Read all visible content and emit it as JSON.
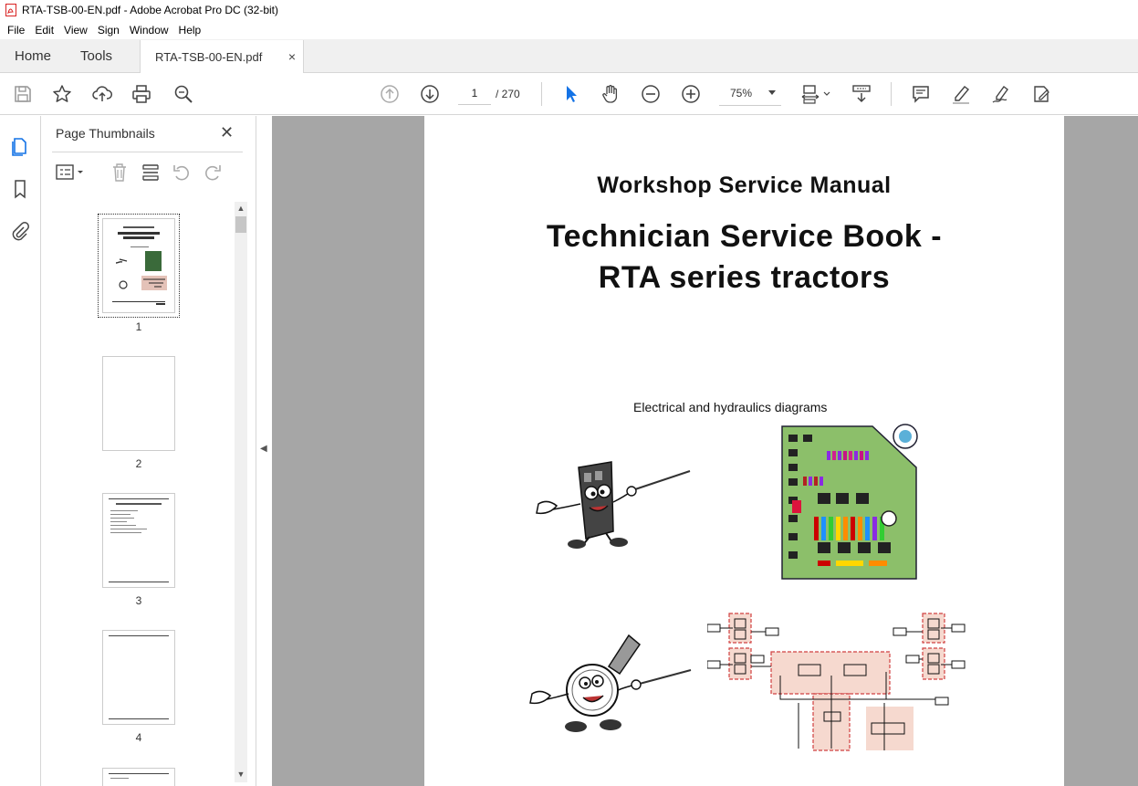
{
  "window": {
    "title": "RTA-TSB-00-EN.pdf - Adobe Acrobat Pro DC (32-bit)"
  },
  "menu": [
    "File",
    "Edit",
    "View",
    "Sign",
    "Window",
    "Help"
  ],
  "tabs": {
    "home": "Home",
    "tools": "Tools",
    "document": "RTA-TSB-00-EN.pdf",
    "close": "×"
  },
  "toolbar": {
    "current_page": "1",
    "total_pages": "/ 270",
    "zoom": "75%",
    "icons": [
      "save-icon",
      "star-icon",
      "upload-icon",
      "print-icon",
      "search-zoom-icon",
      "prev-page-icon",
      "next-page-icon",
      "select-cursor-icon",
      "hand-icon",
      "zoom-out-icon",
      "zoom-in-icon",
      "page-fit-icon",
      "scroll-mode-icon",
      "comment-icon",
      "highlight-icon",
      "sign-icon",
      "edit-pdf-icon"
    ]
  },
  "panel": {
    "title": "Page Thumbnails",
    "close": "✕",
    "thumbnails": [
      {
        "label": "1"
      },
      {
        "label": "2"
      },
      {
        "label": "3"
      },
      {
        "label": "4"
      }
    ]
  },
  "page": {
    "heading": "Workshop Service Manual",
    "title_line1": "Technician Service Book -",
    "title_line2": "RTA series tractors",
    "subtitle": "Electrical and hydraulics diagrams"
  },
  "colors": {
    "doc_background": "#a6a6a6",
    "accent_blue": "#1473e6",
    "pdf_red": "#d92323",
    "fuse_board_green": "#8cbf6a",
    "hydraulic_pink": "#f6d9cf"
  }
}
